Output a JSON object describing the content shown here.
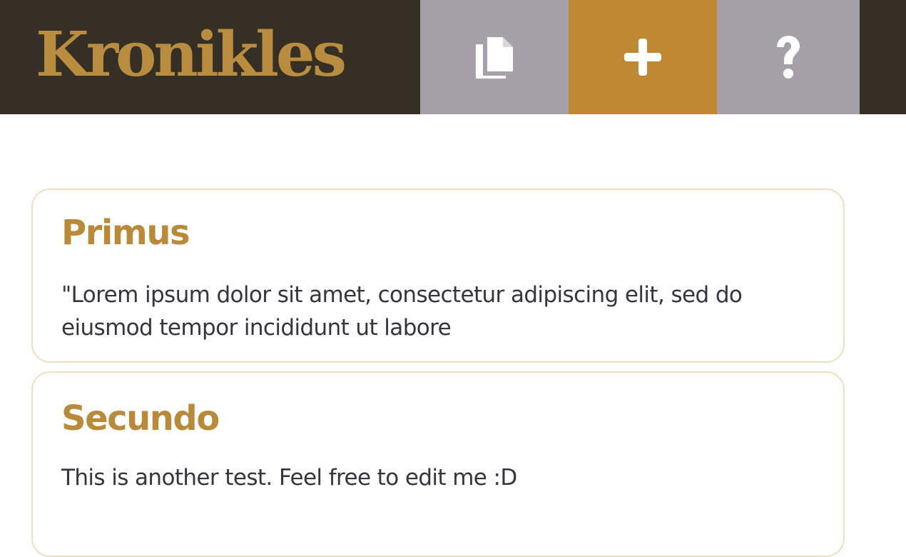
{
  "app": {
    "title": "Kronikles"
  },
  "nav": {
    "items": [
      {
        "icon": "copy-documents-icon",
        "color": "#a6a1a8"
      },
      {
        "icon": "plus-icon",
        "color": "#bf8932"
      },
      {
        "icon": "question-mark-icon",
        "color": "#a6a1a8"
      }
    ]
  },
  "notes": [
    {
      "title": "Primus",
      "body": "\"Lorem ipsum dolor sit amet, consectetur adipiscing elit, sed do eiusmod tempor incididunt ut labore"
    },
    {
      "title": "Secundo",
      "body": "This is another test. Feel free to edit me :D"
    }
  ],
  "colors": {
    "header_bg": "#352f25",
    "brand": "#b98c3f",
    "accent": "#bf8932",
    "nav_grey": "#a6a1a8",
    "card_border": "#ede0c1",
    "title": "#b98a3a",
    "text": "#34353f"
  }
}
